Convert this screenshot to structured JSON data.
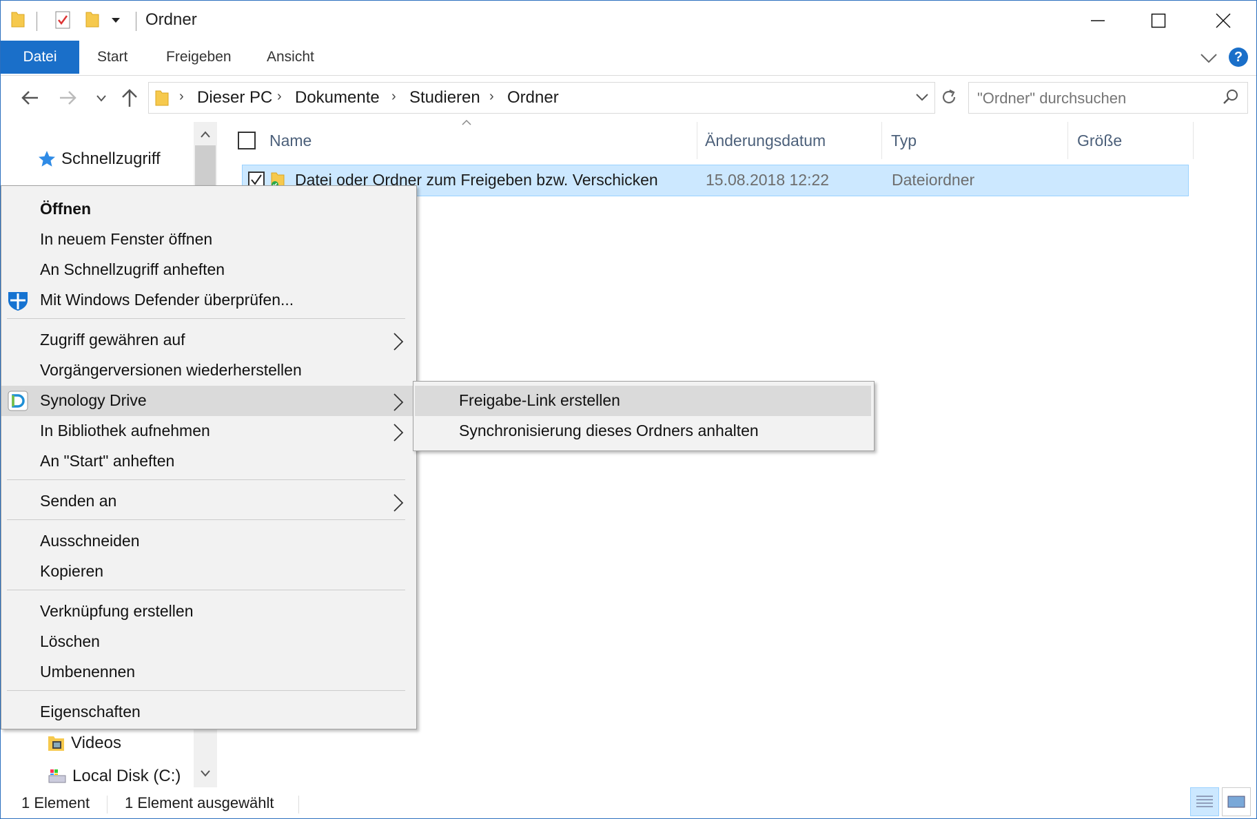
{
  "window": {
    "title": "Ordner",
    "colors": {
      "accent": "#1a6fc9",
      "selection": "#cce8ff",
      "menu_bg": "#f2f2f2",
      "menu_highlight": "#dadada"
    }
  },
  "ribbon": {
    "tabs": [
      {
        "label": "Datei",
        "active": true
      },
      {
        "label": "Start"
      },
      {
        "label": "Freigeben"
      },
      {
        "label": "Ansicht"
      }
    ],
    "help_label": "?"
  },
  "address": {
    "breadcrumbs": [
      "Dieser PC",
      "Dokumente",
      "Studieren",
      "Ordner"
    ]
  },
  "search": {
    "placeholder": "\"Ordner\" durchsuchen"
  },
  "nav_pane": {
    "items": [
      {
        "label": "Schnellzugriff",
        "icon": "star-icon"
      },
      {
        "label": "Videos",
        "icon": "video-folder-icon"
      },
      {
        "label": "Local Disk (C:)",
        "icon": "drive-icon"
      }
    ]
  },
  "columns": [
    "Name",
    "Änderungsdatum",
    "Typ",
    "Größe"
  ],
  "rows": [
    {
      "name": "Datei oder Ordner zum Freigeben bzw. Verschicken",
      "date": "15.08.2018 12:22",
      "type": "Dateiordner",
      "size": ""
    }
  ],
  "context_menu": {
    "items": [
      {
        "label": "Öffnen",
        "bold": true
      },
      {
        "label": "In neuem Fenster öffnen"
      },
      {
        "label": "An Schnellzugriff anheften"
      },
      {
        "label": "Mit Windows Defender überprüfen...",
        "icon": "defender-shield-icon"
      },
      {
        "label": "Zugriff gewähren auf",
        "submenu": true
      },
      {
        "label": "Vorgängerversionen wiederherstellen"
      },
      {
        "label": "Synology Drive",
        "submenu": true,
        "icon": "synology-drive-icon",
        "highlighted": true
      },
      {
        "label": "In Bibliothek aufnehmen",
        "submenu": true
      },
      {
        "label": "An \"Start\" anheften"
      },
      {
        "label": "Senden an",
        "submenu": true
      },
      {
        "label": "Ausschneiden"
      },
      {
        "label": "Kopieren"
      },
      {
        "label": "Verknüpfung erstellen"
      },
      {
        "label": "Löschen"
      },
      {
        "label": "Umbenennen"
      },
      {
        "label": "Eigenschaften"
      }
    ]
  },
  "submenu": {
    "items": [
      {
        "label": "Freigabe-Link erstellen",
        "highlighted": true
      },
      {
        "label": "Synchronisierung dieses Ordners anhalten"
      }
    ]
  },
  "status": {
    "count": "1 Element",
    "selected": "1 Element ausgewählt"
  }
}
